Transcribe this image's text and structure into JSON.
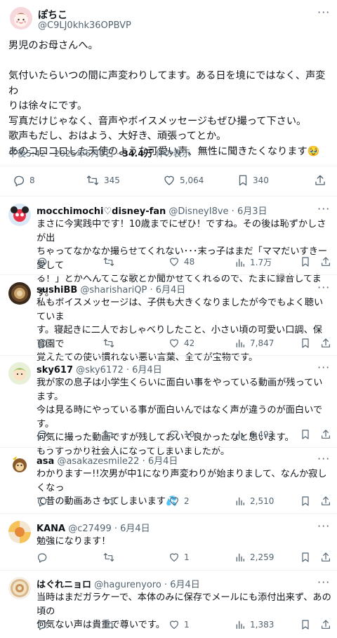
{
  "main": {
    "name": "ぽちこ",
    "handle": "@C9LJ0khk36OPBVP",
    "lines": [
      "男児のお母さんへ。",
      "",
      "気付いたらいつの間に声変わりしてます。ある日を境にではなく、声変わ",
      "りは徐々にです。",
      "写真だけじゃなく、音声やボイスメッセージもぜひ撮って下さい。",
      "歌声もだし、おはよう、大好き、頑張ってとか。",
      "あのコロコロした天使のような可愛い声、無性に聞きたくなります🥹"
    ],
    "time": "午後5:42 · 2025年6月3日 · ",
    "views": "34.4万",
    "views_suffix": " 件の表示",
    "stats": {
      "replies": "8",
      "retweets": "345",
      "likes": "5,064",
      "bookmarks": "340"
    }
  },
  "replies": [
    {
      "name": "mocchimochi♡disney-fan",
      "handle": "@DisneyI8ve · 6月3日",
      "lines": [
        "まさに今実践中です！10歳までにぜひ！ですね。その後は恥ずかしさが出",
        "ちゃってなかなか撮らせてくれない･･･末っ子はまだ「ママだいすきー愛して",
        "る！」とかへんてこな歌とか聞かせてくれるので、たまに録音してます。"
      ],
      "replies": "",
      "retweets": "",
      "likes": "48",
      "views": "1.7万"
    },
    {
      "name": "sushiBB",
      "handle": "@sharishariQP · 6月4日",
      "lines": [
        "私もボイスメッセージは、子供も大きくなりましたが今でもよく聴いていま",
        "す。寝起きに二人でおしゃべりしたこと、小さい頃の可愛い口調、保育園で",
        "覚えたての使い慣れない悪い言葉、全てが宝物です。"
      ],
      "replies": "",
      "retweets": "",
      "likes": "42",
      "views": "7,847"
    },
    {
      "name": "sky617",
      "handle": "@sky6172 · 6月4日",
      "lines": [
        "我が家の息子は小学生くらいに面白い事をやっている動画が残っています。",
        "今は見る時にやっている事が面白いんではなく声が違うのが面白いです。",
        "何気に撮った動画ですが残しておいて良かったなと思います。",
        "もうすっかり社会人になってしまいましたが。"
      ],
      "replies": "",
      "retweets": "",
      "likes": "10",
      "views": "6,493"
    },
    {
      "name": "asa",
      "handle": "@asakazesmile22 · 6月4日",
      "lines": [
        "わかりますー!!次男が中1になり声変わりが始まりまして、なんか寂しくなっ",
        "て昔の動画あさってしまいます💦"
      ],
      "replies": "",
      "retweets": "",
      "likes": "2",
      "views": "2,510"
    },
    {
      "name": "KANA",
      "handle": "@c27499 · 6月4日",
      "lines": [
        "勉強になります！"
      ],
      "replies": "",
      "retweets": "",
      "likes": "1",
      "views": "2,259"
    },
    {
      "name": "はぐれニョロ",
      "handle": "@hagurenyoro · 6月4日",
      "lines": [
        "当時はまだガラケーで、本体のみに保存でメールにも添付出来ず、あの頃の",
        "何気ない声は貴重で尊いです。"
      ],
      "replies": "",
      "retweets": "",
      "likes": "1",
      "views": "1,383"
    }
  ],
  "colors": {
    "text": "#0f1419",
    "muted": "#536471",
    "divider": "#eff3f4"
  }
}
